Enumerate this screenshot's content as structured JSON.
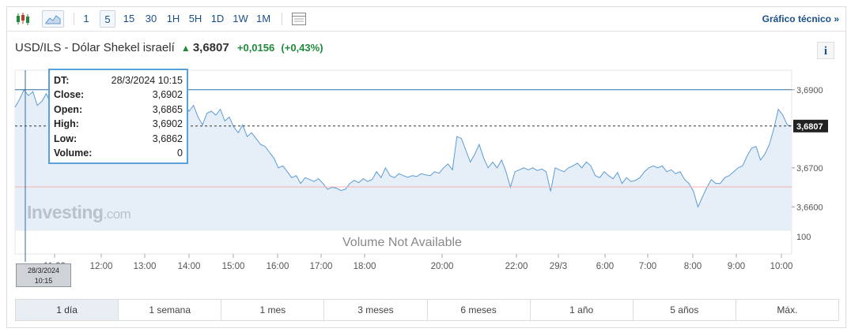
{
  "toolbar": {
    "periods": [
      "1",
      "5",
      "15",
      "30",
      "1H",
      "5H",
      "1D",
      "1W",
      "1M"
    ],
    "selected_period": "5",
    "technical_chart_link": "Gráfico técnico »"
  },
  "header": {
    "pair": "USD/ILS - Dólar Shekel israelí",
    "price": "3,6807",
    "change": "+0,0156",
    "change_pct": "(+0,43%)",
    "info_label": "i"
  },
  "tooltip": {
    "rows": [
      {
        "k": "DT:",
        "v": "28/3/2024 10:15"
      },
      {
        "k": "Close:",
        "v": "3,6902"
      },
      {
        "k": "Open:",
        "v": "3,6865"
      },
      {
        "k": "High:",
        "v": "3,6902"
      },
      {
        "k": "Low:",
        "v": "3,6862"
      },
      {
        "k": "Volume:",
        "v": "0"
      }
    ]
  },
  "crosshair_label": {
    "line1": "28/3/2024",
    "line2": "10:15"
  },
  "watermark": {
    "brand": "Investing",
    "suffix": ".com"
  },
  "volume_note": "Volume Not Available",
  "range_tabs": [
    "1 día",
    "1 semana",
    "1 mes",
    "3 meses",
    "6 meses",
    "1 año",
    "5 años",
    "Máx."
  ],
  "selected_range": "1 día",
  "colors": {
    "line": "#5b9bd5",
    "area": "#e6eff7",
    "accent": "#1a4f8b",
    "up": "#1f8a3a",
    "ref_line": "#f4b2b2"
  },
  "chart_data": {
    "type": "area",
    "y_ticks": [
      "3,6900",
      "3,6700",
      "3,6600"
    ],
    "ylim": [
      3.654,
      3.695
    ],
    "volume_tick": "100",
    "x_labels": [
      "11:00",
      "12:00",
      "13:00",
      "14:00",
      "15:00",
      "16:00",
      "17:00",
      "18:00",
      "20:00",
      "22:00",
      "29/3",
      "6:00",
      "7:00",
      "8:00",
      "9:00",
      "10:00"
    ],
    "last_price": 3.6807,
    "last_price_label": "3,6807",
    "high_line": 3.69,
    "prev_close_line": 3.6651,
    "values": [
      3.6855,
      3.6875,
      3.69,
      3.6885,
      3.6895,
      3.686,
      3.687,
      3.689,
      3.6865,
      3.6855,
      3.6875,
      3.6845,
      3.686,
      3.687,
      3.685,
      3.6865,
      3.687,
      3.6855,
      3.686,
      3.685,
      3.684,
      3.6855,
      3.6845,
      3.686,
      3.6865,
      3.6845,
      3.685,
      3.684,
      3.6855,
      3.686,
      3.685,
      3.6845,
      3.684,
      3.687,
      3.6855,
      3.6845,
      3.6875,
      3.687,
      3.6865,
      3.6845,
      3.686,
      3.683,
      3.681,
      3.684,
      3.6845,
      3.6835,
      3.685,
      3.682,
      3.683,
      3.6805,
      3.679,
      3.681,
      3.678,
      3.679,
      3.6775,
      3.676,
      3.6755,
      3.674,
      3.6725,
      3.67,
      3.6705,
      3.669,
      3.6675,
      3.668,
      3.666,
      3.6675,
      3.667,
      3.6665,
      3.6672,
      3.666,
      3.6645,
      3.665,
      3.6648,
      3.6642,
      3.6645,
      3.666,
      3.6668,
      3.6662,
      3.6672,
      3.6665,
      3.667,
      3.669,
      3.6675,
      3.67,
      3.668,
      3.6675,
      3.6685,
      3.668,
      3.6676,
      3.668,
      3.6678,
      3.6685,
      3.6682,
      3.668,
      3.669,
      3.6686,
      3.67,
      3.671,
      3.6695,
      3.678,
      3.6775,
      3.6745,
      3.6715,
      3.6735,
      3.676,
      3.6725,
      3.67,
      3.6715,
      3.67,
      3.672,
      3.669,
      3.665,
      3.669,
      3.6695,
      3.67,
      3.6695,
      3.67,
      3.6693,
      3.6697,
      3.669,
      3.664,
      3.67,
      3.6695,
      3.669,
      3.67,
      3.6705,
      3.6712,
      3.67,
      3.6715,
      3.6705,
      3.668,
      3.6675,
      3.669,
      3.668,
      3.6672,
      3.6688,
      3.666,
      3.6675,
      3.6665,
      3.6668,
      3.6675,
      3.669,
      3.67,
      3.6705,
      3.67,
      3.6705,
      3.669,
      3.6695,
      3.6685,
      3.669,
      3.667,
      3.666,
      3.664,
      3.66,
      3.6625,
      3.665,
      3.667,
      3.666,
      3.666,
      3.6675,
      3.668,
      3.669,
      3.67,
      3.6705,
      3.673,
      3.675,
      3.6755,
      3.672,
      3.6735,
      3.676,
      3.68,
      3.685,
      3.6835,
      3.681,
      3.6807
    ]
  }
}
